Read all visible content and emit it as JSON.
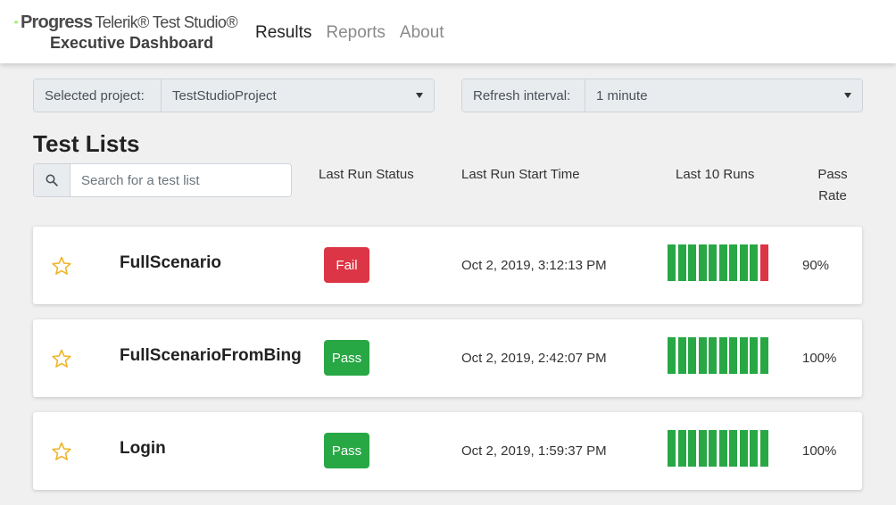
{
  "header": {
    "brand_progress": "Progress",
    "brand_product": "Telerik® Test Studio®",
    "brand_subtitle": "Executive Dashboard",
    "nav": [
      {
        "label": "Results",
        "active": true
      },
      {
        "label": "Reports",
        "active": false
      },
      {
        "label": "About",
        "active": false
      }
    ]
  },
  "project_select": {
    "label": "Selected project:",
    "value": "TestStudioProject"
  },
  "refresh_select": {
    "label": "Refresh interval:",
    "value": "1 minute"
  },
  "section_title": "Test Lists",
  "search": {
    "placeholder": "Search for a test list",
    "value": ""
  },
  "columns": {
    "status": "Last Run Status",
    "start_time": "Last Run Start Time",
    "last_runs": "Last 10 Runs",
    "pass_rate": "Pass Rate"
  },
  "colors": {
    "pass": "#28a745",
    "fail": "#dc3545",
    "star": "#f0b429",
    "logo": "#5ce500"
  },
  "icons": {
    "logo": "progress-logo-icon",
    "search": "search-icon",
    "caret": "caret-down-icon",
    "favorite": "star-outline-icon"
  },
  "test_lists": [
    {
      "name": "FullScenario",
      "status": "Fail",
      "start_time": "Oct 2, 2019, 3:12:13 PM",
      "last_runs": [
        "pass",
        "pass",
        "pass",
        "pass",
        "pass",
        "pass",
        "pass",
        "pass",
        "pass",
        "fail"
      ],
      "pass_rate": "90%"
    },
    {
      "name": "FullScenarioFromBing",
      "status": "Pass",
      "start_time": "Oct 2, 2019, 2:42:07 PM",
      "last_runs": [
        "pass",
        "pass",
        "pass",
        "pass",
        "pass",
        "pass",
        "pass",
        "pass",
        "pass",
        "pass"
      ],
      "pass_rate": "100%"
    },
    {
      "name": "Login",
      "status": "Pass",
      "start_time": "Oct 2, 2019, 1:59:37 PM",
      "last_runs": [
        "pass",
        "pass",
        "pass",
        "pass",
        "pass",
        "pass",
        "pass",
        "pass",
        "pass",
        "pass"
      ],
      "pass_rate": "100%"
    }
  ]
}
